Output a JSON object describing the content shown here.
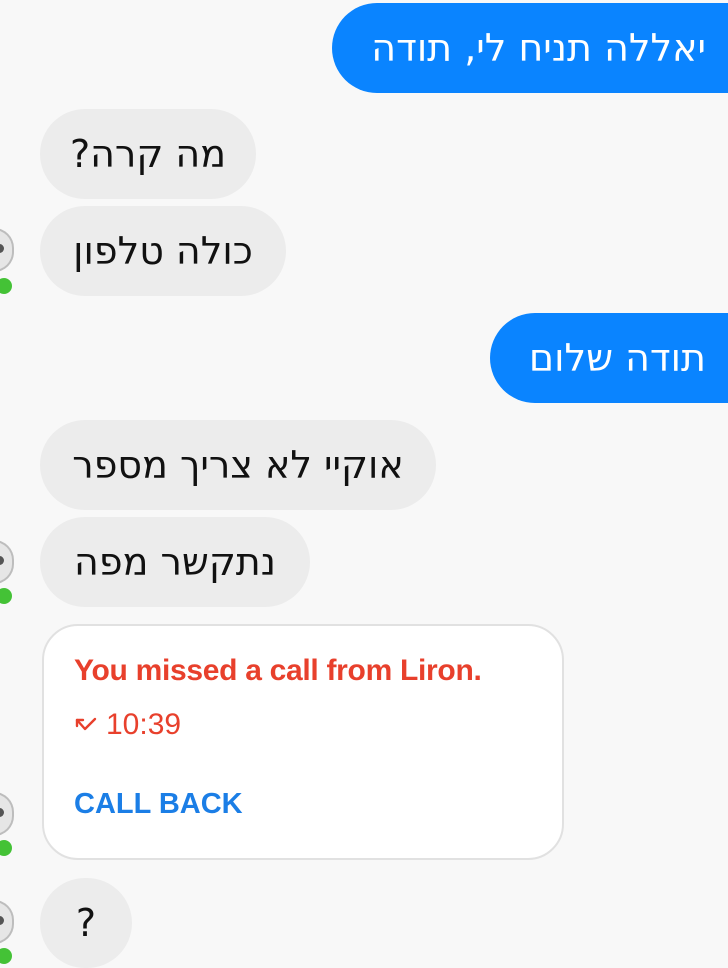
{
  "messages": [
    {
      "direction": "outgoing",
      "text": "יאללה תניח לי, תודה"
    },
    {
      "direction": "incoming",
      "text": "מה קרה?"
    },
    {
      "direction": "incoming",
      "text": "כולה טלפון"
    },
    {
      "direction": "outgoing",
      "text": "תודה שלום"
    },
    {
      "direction": "incoming",
      "text": "אוקיי לא צריך מספר"
    },
    {
      "direction": "incoming",
      "text": "נתקשר מפה"
    },
    {
      "direction": "incoming",
      "text": "?"
    }
  ],
  "missed_call": {
    "title": "You missed a call from Liron.",
    "time": "10:39",
    "action_label": "CALL BACK",
    "icon": "missed-call-arrow-icon"
  },
  "colors": {
    "outgoing_bubble": "#0a84ff",
    "incoming_bubble": "#ececec",
    "missed_call_text": "#e8402c",
    "call_back": "#1b7ee6",
    "presence_dot": "#44c236"
  }
}
